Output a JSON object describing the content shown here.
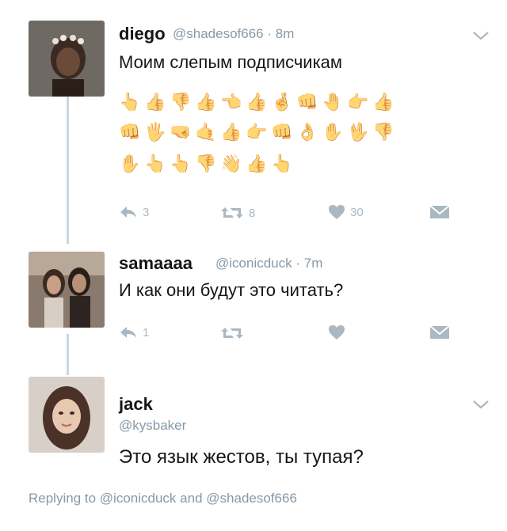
{
  "tweets": [
    {
      "name": "diego",
      "handle": "@shadesof666",
      "time": "8m",
      "text": "Моим слепым подписчикам",
      "emoji_rows": [
        [
          "👆",
          "👍",
          "👎",
          "👍",
          "👈",
          "👍",
          "🤞",
          "👊",
          "🤚",
          "👉",
          "👍"
        ],
        [
          "👊",
          "🖐",
          "🤜",
          "🤙",
          "👍",
          "👉",
          "👊",
          "👌",
          "✋",
          "🖖",
          "👎"
        ],
        [
          "✋",
          "👆",
          "👆",
          "👎",
          "👋",
          "👍",
          "👆"
        ]
      ],
      "actions": {
        "reply": "3",
        "retweet": "8",
        "like": "30"
      }
    },
    {
      "name": "samaaaa",
      "handle": "@iconicduck",
      "time": "7m",
      "text": "И как они будут это читать?",
      "actions": {
        "reply": "1",
        "retweet": "",
        "like": ""
      }
    },
    {
      "name": "jack",
      "handle": "@kysbaker",
      "text": "Это язык жестов, ты тупая?"
    }
  ],
  "replying": {
    "prefix": "Replying to",
    "mention1": "@iconicduck",
    "joiner": "and",
    "mention2": "@shadesof666"
  },
  "colors": {
    "text": "#14171a",
    "muted": "#8899a6",
    "icon": "#aab8c2",
    "line": "#ccd6dd"
  }
}
